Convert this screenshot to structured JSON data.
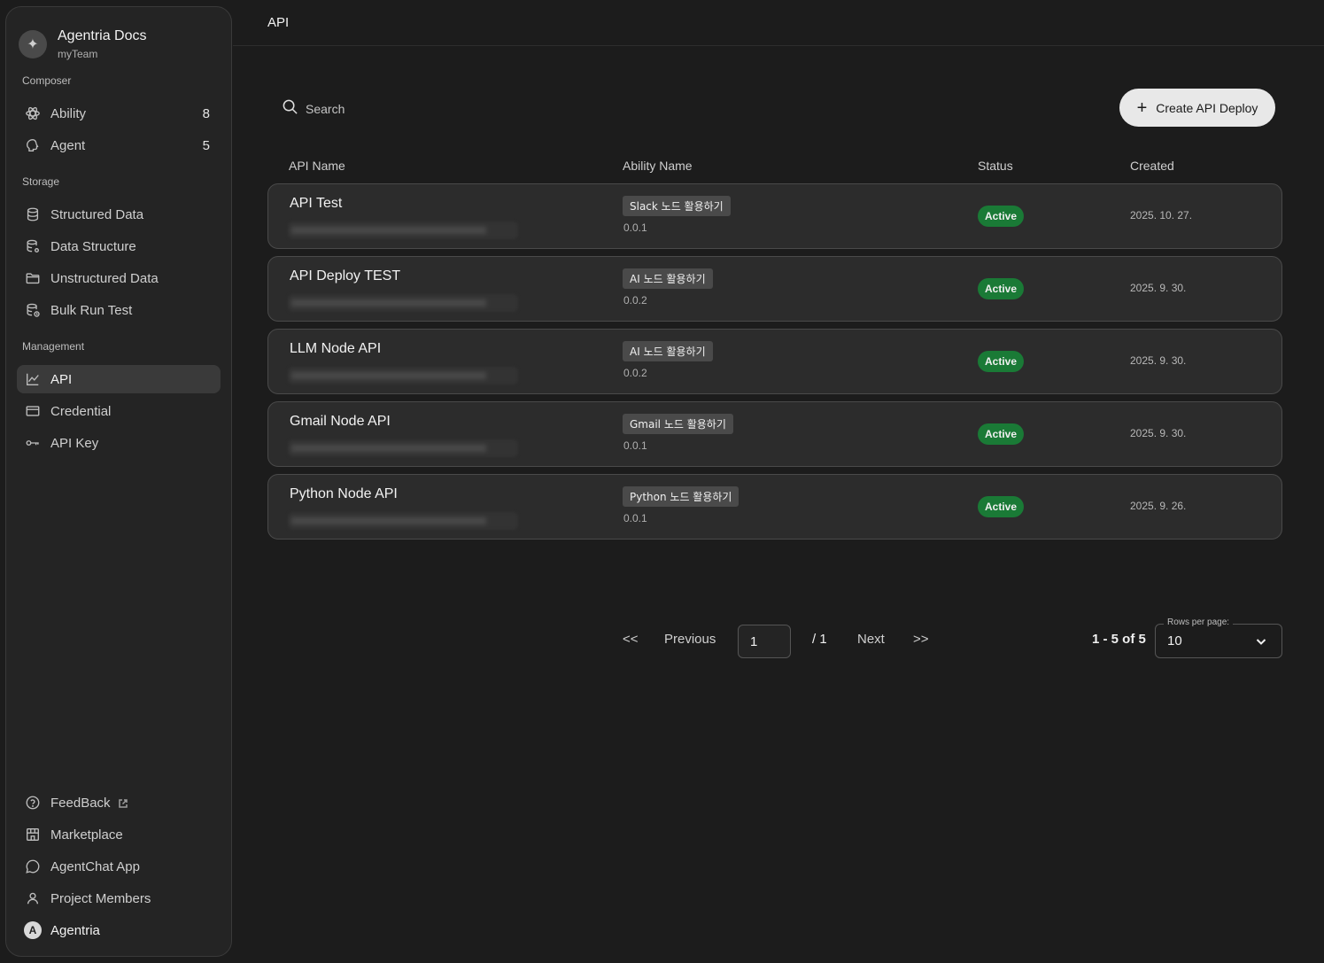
{
  "sidebar": {
    "brand_title": "Agentria Docs",
    "brand_sub": "myTeam",
    "composer_label": "Composer",
    "ability_label": "Ability",
    "ability_count": "8",
    "agent_label": "Agent",
    "agent_count": "5",
    "storage_label": "Storage",
    "structured_data": "Structured Data",
    "data_structure": "Data Structure",
    "unstructured_data": "Unstructured Data",
    "bulk_run_test": "Bulk Run Test",
    "management_label": "Management",
    "api": "API",
    "credential": "Credential",
    "api_key": "API Key",
    "feedback": "FeedBack",
    "marketplace": "Marketplace",
    "agentchat_app": "AgentChat App",
    "project_members": "Project Members",
    "user_initial": "A",
    "user_name": "Agentria"
  },
  "header": {
    "title": "API"
  },
  "toolbar": {
    "search_placeholder": "Search",
    "create_label": "Create API Deploy"
  },
  "table": {
    "columns": [
      "API Name",
      "Ability Name",
      "Status",
      "Created"
    ],
    "rows": [
      {
        "name": "API Test",
        "ability": "Slack 노드 활용하기",
        "version": "0.0.1",
        "status": "Active",
        "created": "2025. 10. 27."
      },
      {
        "name": "API Deploy TEST",
        "ability": "AI 노드 활용하기",
        "version": "0.0.2",
        "status": "Active",
        "created": "2025. 9. 30."
      },
      {
        "name": "LLM Node API",
        "ability": "AI 노드 활용하기",
        "version": "0.0.2",
        "status": "Active",
        "created": "2025. 9. 30."
      },
      {
        "name": "Gmail Node API",
        "ability": "Gmail 노드 활용하기",
        "version": "0.0.1",
        "status": "Active",
        "created": "2025. 9. 30."
      },
      {
        "name": "Python Node API",
        "ability": "Python 노드 활용하기",
        "version": "0.0.1",
        "status": "Active",
        "created": "2025. 9. 26."
      }
    ]
  },
  "pagination": {
    "first": "<<",
    "previous": "Previous",
    "page_value": "1",
    "total": "/ 1",
    "next": "Next",
    "last": ">>",
    "range": "1 - 5 of 5",
    "rows_per_page_label": "Rows per page:",
    "rows_per_page_value": "10"
  },
  "colors": {
    "background": "#1c1c1c",
    "sidebar": "#242424",
    "row": "#2c2c2c",
    "active_badge": "#1a7a36",
    "button": "#e8e8e8"
  }
}
